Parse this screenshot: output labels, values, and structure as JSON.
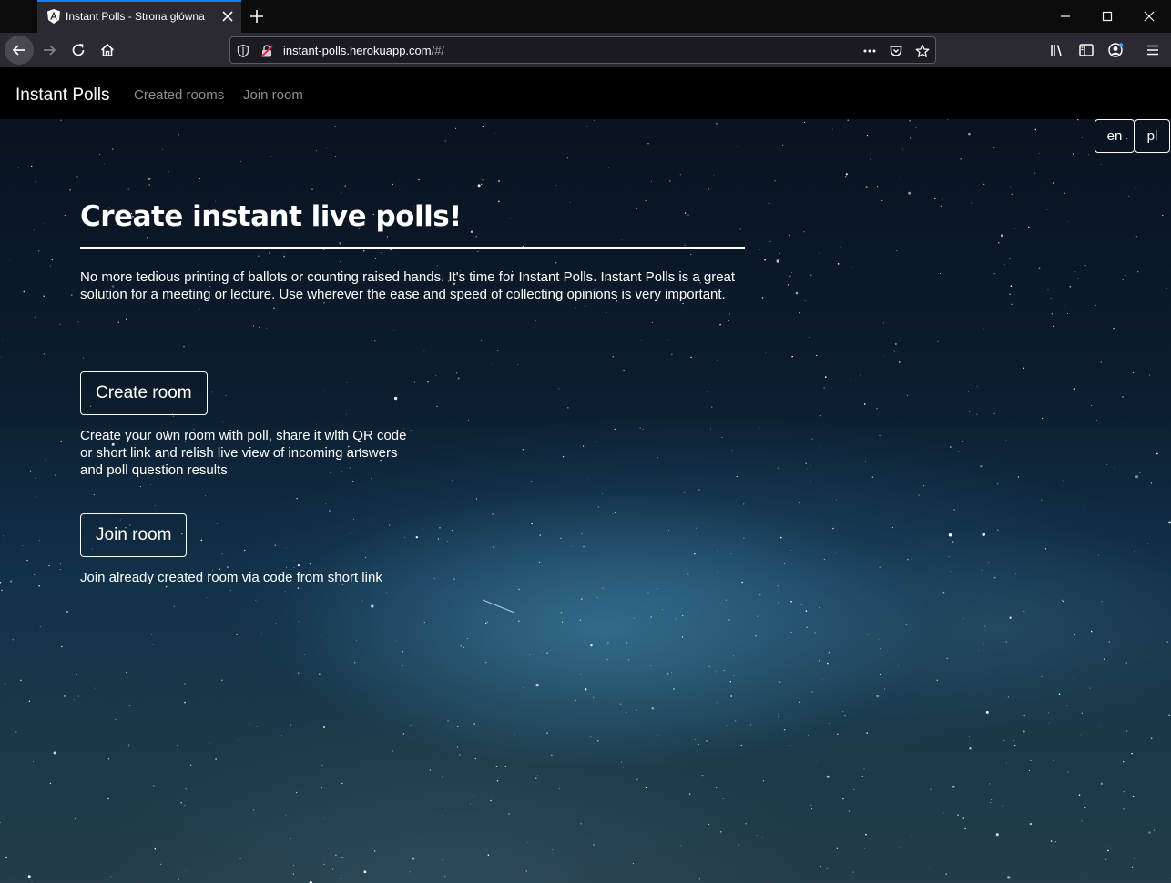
{
  "browser": {
    "tab_title": "Instant Polls - Strona główna",
    "url_host": "instant-polls.herokuapp.com",
    "url_path": "/#/",
    "icons": [
      "angular-favicon-icon",
      "close-tab-icon",
      "new-tab-icon",
      "minimize-icon",
      "maximize-icon",
      "close-window-icon",
      "back-icon",
      "forward-icon",
      "reload-icon",
      "home-icon",
      "shield-icon",
      "insecure-lock-icon",
      "more-icon",
      "pocket-icon",
      "bookmark-star-icon",
      "library-icon",
      "sidebar-icon",
      "account-icon",
      "menu-icon"
    ]
  },
  "site": {
    "brand": "Instant Polls",
    "nav": [
      "Created rooms",
      "Join room"
    ],
    "languages": [
      "en",
      "pl"
    ],
    "headline": "Create instant live polls!",
    "intro": "No more tedious printing of ballots or counting raised hands. It's time for Instant Polls. Instant Polls is a great solution for a meeting or lecture. Use wherever the ease and speed of collecting opinions is very important.",
    "create_button": "Create room",
    "create_desc": "Create your own room with poll, share it with QR code or short link and relish live view of incoming answers and poll question results",
    "join_button": "Join room",
    "join_desc": "Join already created room via code from short link"
  },
  "colors": {
    "chrome_bg": "#0c0c0d",
    "toolbar_bg": "#2b2a33",
    "tab_accent": "#0a84ff",
    "site_nav_bg": "#000000",
    "nav_link": "#8e8e8e"
  }
}
